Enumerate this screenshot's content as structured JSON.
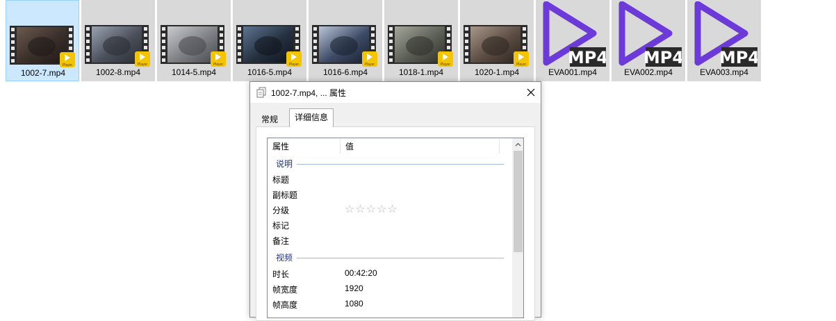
{
  "files": [
    {
      "name": "1002-7.mp4",
      "kind": "video-thumb",
      "selected": true
    },
    {
      "name": "1002-8.mp4",
      "kind": "video-thumb",
      "selected": false
    },
    {
      "name": "1014-5.mp4",
      "kind": "video-thumb",
      "selected": false
    },
    {
      "name": "1016-5.mp4",
      "kind": "video-thumb",
      "selected": false
    },
    {
      "name": "1016-6.mp4",
      "kind": "video-thumb",
      "selected": false
    },
    {
      "name": "1018-1.mp4",
      "kind": "video-thumb",
      "selected": false
    },
    {
      "name": "1020-1.mp4",
      "kind": "video-thumb",
      "selected": false
    },
    {
      "name": "EVA001.mp4",
      "kind": "mp4-icon",
      "selected": false
    },
    {
      "name": "EVA002.mp4",
      "kind": "mp4-icon",
      "selected": false
    },
    {
      "name": "EVA003.mp4",
      "kind": "mp4-icon",
      "selected": false
    }
  ],
  "badges": {
    "player": "Player",
    "mp4": "MP4"
  },
  "dialog": {
    "title": "1002-7.mp4, ... 属性",
    "title_icon": "files-properties-icon",
    "close_icon": "close-icon",
    "tabs": [
      {
        "label": "常规",
        "active": false
      },
      {
        "label": "详细信息",
        "active": true
      }
    ],
    "columns": {
      "property": "属性",
      "value": "值"
    },
    "groups": {
      "description": {
        "label": "说明",
        "items": [
          {
            "name": "标题",
            "value": ""
          },
          {
            "name": "副标题",
            "value": ""
          },
          {
            "name": "分级",
            "value": "",
            "stars": 0
          },
          {
            "name": "标记",
            "value": ""
          },
          {
            "name": "备注",
            "value": ""
          }
        ]
      },
      "video": {
        "label": "视频",
        "items": [
          {
            "name": "时长",
            "value": "00:42:20"
          },
          {
            "name": "帧宽度",
            "value": "1920"
          },
          {
            "name": "帧高度",
            "value": "1080"
          }
        ]
      }
    }
  },
  "colors": {
    "selection_bg": "#cce8ff",
    "tile_bg": "#d9d9d9",
    "mp4_purple": "#6c3ad8",
    "player_badge": "#f5c400",
    "group_text": "#1e3287"
  }
}
